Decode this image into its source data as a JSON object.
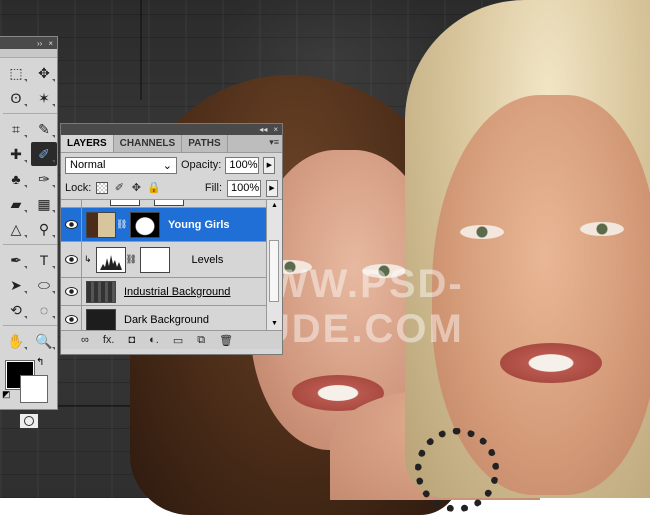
{
  "watermark": "WWW.PSD-DUDE.COM",
  "tools_panel": {
    "header_controls": [
      "››",
      "×"
    ],
    "tools": [
      {
        "name": "marquee-icon",
        "glyph": "⬚"
      },
      {
        "name": "move-icon",
        "glyph": "✥"
      },
      {
        "name": "lasso-icon",
        "glyph": "ʘ"
      },
      {
        "name": "magic-wand-icon",
        "glyph": "✶"
      },
      {
        "name": "crop-icon",
        "glyph": "⌗"
      },
      {
        "name": "eyedropper-icon",
        "glyph": "✎"
      },
      {
        "name": "healing-brush-icon",
        "glyph": "✚"
      },
      {
        "name": "brush-icon",
        "glyph": "✐",
        "selected": true
      },
      {
        "name": "clone-stamp-icon",
        "glyph": "♣"
      },
      {
        "name": "history-brush-icon",
        "glyph": "✑"
      },
      {
        "name": "eraser-icon",
        "glyph": "▰"
      },
      {
        "name": "gradient-icon",
        "glyph": "▦"
      },
      {
        "name": "blur-icon",
        "glyph": "△"
      },
      {
        "name": "dodge-icon",
        "glyph": "⚲"
      },
      {
        "name": "pen-icon",
        "glyph": "✒"
      },
      {
        "name": "type-icon",
        "glyph": "T"
      },
      {
        "name": "path-selection-icon",
        "glyph": "➤"
      },
      {
        "name": "ellipse-shape-icon",
        "glyph": "⬭"
      },
      {
        "name": "3d-rotate-icon",
        "glyph": "⟲"
      },
      {
        "name": "3d-orbit-icon",
        "glyph": "◌"
      },
      {
        "name": "hand-icon",
        "glyph": "✋"
      },
      {
        "name": "zoom-icon",
        "glyph": "🔍"
      }
    ],
    "swap_glyph": "↰",
    "default_colors_glyph": "◩",
    "foreground_color": "#000000",
    "background_color": "#ffffff"
  },
  "layers_panel": {
    "header_controls": [
      "◂◂",
      "×"
    ],
    "tabs": [
      "LAYERS",
      "CHANNELS",
      "PATHS"
    ],
    "menu_glyph": "▾≡",
    "blend_mode": "Normal",
    "opacity_label": "Opacity:",
    "opacity_value": "100%",
    "lock_label": "Lock:",
    "fill_label": "Fill:",
    "fill_value": "100%",
    "layers": [
      {
        "name": "Young Girls",
        "selected": true
      },
      {
        "name": "Levels",
        "selected": false
      },
      {
        "name": "Industrial Background",
        "selected": false
      },
      {
        "name": "Dark Background",
        "selected": false
      }
    ],
    "footer_icons": [
      "∞",
      "fx.",
      "◘",
      "◐.",
      "▭",
      "⧉",
      "🗑"
    ]
  },
  "colors": {
    "selection_blue": "#1f6fd6",
    "panel_gray": "#d6d6d6"
  }
}
